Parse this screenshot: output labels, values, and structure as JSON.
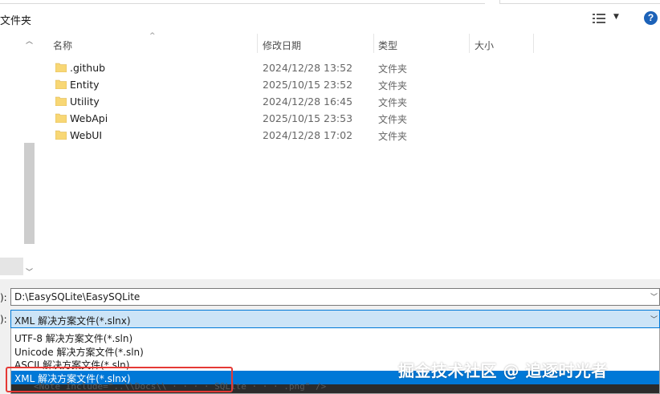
{
  "toolbar": {
    "new_folder_label": "文件夹",
    "view_icon": "view-list-icon",
    "help_icon": "help-icon",
    "help_glyph": "?"
  },
  "columns": [
    {
      "label": "名称"
    },
    {
      "label": "修改日期"
    },
    {
      "label": "类型"
    },
    {
      "label": "大小"
    }
  ],
  "files": [
    {
      "name": ".github",
      "modified": "2024/12/28 13:52",
      "type": "文件夹"
    },
    {
      "name": "Entity",
      "modified": "2025/10/15 23:52",
      "type": "文件夹"
    },
    {
      "name": "Utility",
      "modified": "2024/12/28 16:45",
      "type": "文件夹"
    },
    {
      "name": "WebApi",
      "modified": "2025/10/15 23:53",
      "type": "文件夹"
    },
    {
      "name": "WebUI",
      "modified": "2024/12/28 17:02",
      "type": "文件夹"
    }
  ],
  "bottom": {
    "path_label_fragment": "):",
    "path_value": "D:\\EasySQLite\\EasySQLite",
    "type_label_fragment": "):",
    "type_selected": "XML 解决方案文件(*.slnx)",
    "type_options": [
      "UTF-8 解决方案文件(*.sln)",
      "Unicode 解决方案文件(*.sln)",
      "ASCII 解决方案文件(*.sln)",
      "XML 解决方案文件(*.slnx)"
    ],
    "ghost_text": "<Note Include=\"..\\\\Docs\\\\ · · · · SQLite · · · .png\" />"
  },
  "watermark": "掘金技术社区 @ 追逐时光者",
  "colors": {
    "accent": "#0078d7",
    "selection_bg": "#cce4f7",
    "folder_yellow": "#f8d775",
    "highlight_box": "#e53935"
  }
}
